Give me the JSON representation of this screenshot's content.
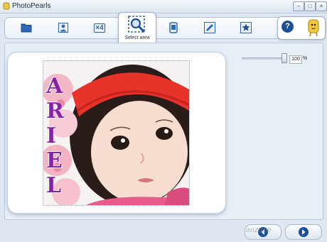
{
  "window": {
    "title": "PhotoPearls"
  },
  "toolbar": {
    "selected_tool_label": "Select area",
    "tools": [
      "folder-icon",
      "portrait-icon",
      "x4-icon",
      "zoom-select-icon",
      "phone-frame-icon",
      "pencil-icon",
      "star-icon",
      "help-icon",
      "pearl-mascot-icon"
    ],
    "x4_label": "×4"
  },
  "photo": {
    "name_letters": [
      "A",
      "R",
      "I",
      "E",
      "L"
    ]
  },
  "zoom": {
    "value": "100",
    "unit": "%",
    "level_percent": 100
  },
  "footer": {
    "watermark": "anzapp"
  },
  "colors": {
    "accent": "#2c5fa8",
    "headband": "#e8332b",
    "name_text": "#8a1fa8"
  }
}
